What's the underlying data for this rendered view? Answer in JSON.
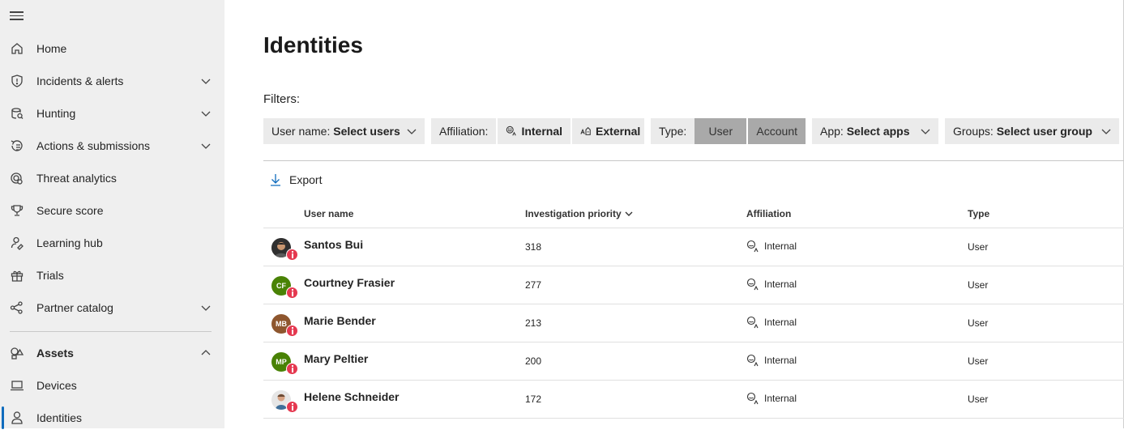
{
  "sidebar": {
    "items": [
      {
        "label": "Home",
        "icon": "home-icon",
        "chevron": "none"
      },
      {
        "label": "Incidents & alerts",
        "icon": "shield-icon",
        "chevron": "down"
      },
      {
        "label": "Hunting",
        "icon": "hunting-icon",
        "chevron": "down"
      },
      {
        "label": "Actions & submissions",
        "icon": "actions-icon",
        "chevron": "down"
      },
      {
        "label": "Threat analytics",
        "icon": "threat-analytics-icon",
        "chevron": "none"
      },
      {
        "label": "Secure score",
        "icon": "trophy-icon",
        "chevron": "none"
      },
      {
        "label": "Learning hub",
        "icon": "learning-icon",
        "chevron": "none"
      },
      {
        "label": "Trials",
        "icon": "gift-icon",
        "chevron": "none"
      },
      {
        "label": "Partner catalog",
        "icon": "partner-icon",
        "chevron": "down"
      }
    ],
    "assets": {
      "label": "Assets",
      "icon": "assets-icon",
      "chevron": "up"
    },
    "sub_items": [
      {
        "label": "Devices",
        "icon": "laptop-icon"
      },
      {
        "label": "Identities",
        "icon": "person-icon",
        "active": true
      }
    ]
  },
  "page": {
    "title": "Identities"
  },
  "filters": {
    "label": "Filters:",
    "user_name": {
      "label": "User name:",
      "value": "Select users"
    },
    "affiliation": {
      "label": "Affiliation:",
      "internal": "Internal",
      "external": "External"
    },
    "type": {
      "label": "Type:",
      "user": "User",
      "account": "Account"
    },
    "app": {
      "label": "App:",
      "value": "Select apps"
    },
    "groups": {
      "label": "Groups:",
      "value": "Select user group"
    }
  },
  "toolbar": {
    "export_label": "Export"
  },
  "table": {
    "columns": {
      "user_name": "User name",
      "priority": "Investigation priority",
      "affiliation": "Affiliation",
      "type": "Type"
    },
    "rows": [
      {
        "name": "Santos Bui",
        "initials": "",
        "avatar_color": "#3a3a3a",
        "priority": "318",
        "affiliation": "Internal",
        "type": "User",
        "photo": true
      },
      {
        "name": "Courtney Frasier",
        "initials": "CF",
        "avatar_color": "#498205",
        "priority": "277",
        "affiliation": "Internal",
        "type": "User",
        "photo": false
      },
      {
        "name": "Marie Bender",
        "initials": "MB",
        "avatar_color": "#8e562e",
        "priority": "213",
        "affiliation": "Internal",
        "type": "User",
        "photo": false
      },
      {
        "name": "Mary Peltier",
        "initials": "MP",
        "avatar_color": "#498205",
        "priority": "200",
        "affiliation": "Internal",
        "type": "User",
        "photo": false
      },
      {
        "name": "Helene Schneider",
        "initials": "",
        "avatar_color": "#d8d8d8",
        "priority": "172",
        "affiliation": "Internal",
        "type": "User",
        "photo": true
      }
    ]
  },
  "colors": {
    "accent": "#0f6cbd",
    "badge": "#e53950",
    "selected_segment": "#a9a9a9"
  }
}
